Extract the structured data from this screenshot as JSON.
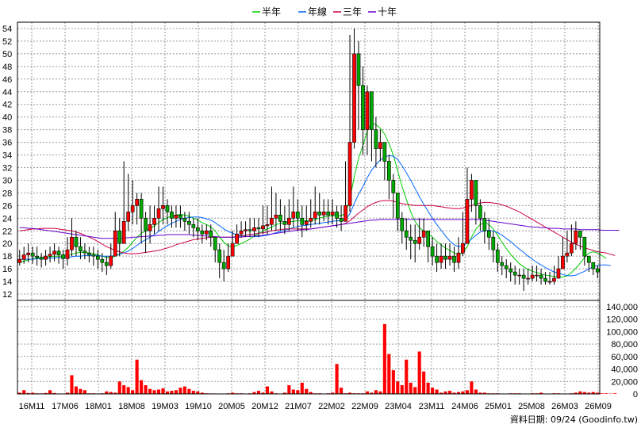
{
  "legend": [
    {
      "label": "半年",
      "color": "#00cc00"
    },
    {
      "label": "年線",
      "color": "#0066ff"
    },
    {
      "label": "三年",
      "color": "#cc0044"
    },
    {
      "label": "十年",
      "color": "#6600cc"
    }
  ],
  "source_text": "資料日期: 09/24  (Goodinfo.tw)",
  "colors": {
    "up": "#ff0000",
    "down": "#00aa00",
    "volume": "#ff0000",
    "grid": "#999999"
  },
  "chart_data": {
    "type": "candlestick+bar",
    "price_axis": {
      "ticks": [
        12,
        14,
        16,
        18,
        20,
        22,
        24,
        26,
        28,
        30,
        32,
        34,
        36,
        38,
        40,
        42,
        44,
        46,
        48,
        50,
        52,
        54
      ],
      "ylim": [
        11,
        55
      ]
    },
    "volume_axis": {
      "ticks": [
        "0",
        "20,000",
        "40,000",
        "60,000",
        "80,000",
        "100,000",
        "120,000",
        "140,000"
      ],
      "ylim": [
        0,
        150000
      ]
    },
    "x_labels": [
      "16M11",
      "17M06",
      "18M01",
      "18M08",
      "19M03",
      "19M10",
      "20M05",
      "20M12",
      "21M07",
      "22M02",
      "22M09",
      "23M04",
      "23M11",
      "24M06",
      "25M01",
      "25M08",
      "26M03",
      "26M09"
    ],
    "close": [
      17.5,
      18.2,
      18.5,
      18,
      17.8,
      17.5,
      18,
      18.3,
      18.8,
      18.2,
      17.6,
      19,
      21,
      19.5,
      18.8,
      18.5,
      18.2,
      18,
      17.5,
      17,
      16.5,
      18,
      22,
      20,
      23.5,
      25,
      26,
      27,
      24,
      22,
      23,
      24,
      25.5,
      26,
      25,
      24,
      24.5,
      24,
      23.5,
      23,
      22.5,
      22,
      21.5,
      22,
      21,
      19,
      17,
      16,
      18,
      20,
      21.5,
      22,
      22.2,
      22,
      22.5,
      22.3,
      22.8,
      23,
      24,
      24.5,
      23.5,
      23,
      24,
      25,
      24,
      23,
      23.5,
      24,
      25,
      24.5,
      25,
      24.5,
      25,
      24,
      23.5,
      26,
      36,
      50,
      45,
      38,
      44,
      38,
      35,
      36,
      33,
      30,
      28,
      24,
      22,
      21,
      20.5,
      20,
      21,
      22,
      19.5,
      18,
      17,
      18,
      17.5,
      18,
      17,
      18.5,
      20,
      27,
      30,
      26,
      24,
      22,
      21,
      19,
      17,
      16.5,
      16,
      15.5,
      15,
      15,
      14.5,
      14.5,
      15,
      15,
      14.5,
      14,
      14,
      14.5,
      16,
      18,
      18.5,
      20,
      22,
      21,
      18,
      17,
      16,
      15.5
    ],
    "high": [
      19,
      19.5,
      20,
      19.5,
      19.5,
      18.5,
      19,
      19.5,
      20,
      19.5,
      19,
      21,
      24,
      22,
      21,
      20,
      19.5,
      19.5,
      19,
      18.5,
      18,
      20,
      25,
      24,
      33,
      31,
      30,
      28,
      28,
      25,
      26,
      26,
      29,
      29,
      27,
      26,
      26,
      26,
      25,
      25,
      24,
      24,
      23,
      23,
      23,
      21,
      20,
      19,
      20,
      22,
      23,
      23.5,
      23.5,
      24,
      24,
      24,
      26,
      26,
      29,
      28,
      27,
      26,
      27,
      29,
      27,
      26,
      26,
      27,
      29,
      28,
      27,
      27,
      27,
      26,
      26,
      33,
      53,
      54,
      52,
      48,
      45,
      42,
      40,
      38,
      36,
      34,
      31,
      28,
      25,
      24,
      23,
      23,
      24,
      24,
      22,
      21,
      20,
      20,
      20,
      20,
      19.5,
      21,
      25,
      32,
      31,
      29,
      27,
      25,
      24,
      22,
      20,
      18,
      17.5,
      17,
      16.5,
      16,
      16,
      16,
      16.5,
      16.5,
      16,
      15.5,
      15.5,
      16.5,
      18,
      21,
      22,
      23,
      23.5,
      22,
      20,
      18,
      17,
      16.5
    ],
    "low": [
      16.5,
      16.8,
      17,
      16.8,
      16.5,
      16.2,
      16.5,
      17,
      17.2,
      16.8,
      16,
      16.5,
      18,
      18,
      17.5,
      17.5,
      17,
      16.5,
      16,
      15.5,
      15,
      16,
      18,
      18,
      21,
      22,
      23,
      23,
      20,
      18.5,
      20,
      21.5,
      22,
      23,
      23,
      22.5,
      22.5,
      22.5,
      22,
      21.5,
      21,
      20.5,
      20,
      20.5,
      19.5,
      17,
      14.5,
      14,
      15.5,
      18,
      20,
      21,
      21,
      21,
      21,
      21,
      21.5,
      21.5,
      22,
      22,
      22,
      21.5,
      22,
      22.5,
      22,
      21,
      22,
      22.5,
      23,
      23,
      23.5,
      23,
      23,
      22.5,
      22,
      24,
      25,
      35,
      38,
      34,
      34,
      33,
      32,
      33,
      30,
      27,
      24,
      22,
      20,
      19,
      17.5,
      17,
      19,
      19.5,
      17,
      16.5,
      15.5,
      16,
      16,
      16.5,
      15.5,
      16,
      18,
      23,
      25,
      23,
      22,
      20,
      19,
      17,
      15.5,
      15,
      14.5,
      14,
      13.5,
      13.5,
      12.5,
      13.5,
      14,
      14,
      13.5,
      13.5,
      13.5,
      13.5,
      14.5,
      16,
      17,
      18,
      19,
      19,
      16.5,
      15.5,
      15,
      14.5
    ],
    "ma_half": [
      17,
      17.2,
      17.4,
      17.6,
      17.7,
      17.8,
      17.8,
      17.9,
      18,
      18,
      18,
      18.1,
      18.3,
      18.5,
      18.6,
      18.6,
      18.5,
      18.4,
      18.2,
      18,
      17.8,
      17.7,
      18,
      18.3,
      18.8,
      19.4,
      20.2,
      21,
      21.6,
      22,
      22.4,
      22.8,
      23.3,
      23.8,
      24.1,
      24.3,
      24.5,
      24.6,
      24.5,
      24.3,
      24,
      23.7,
      23.3,
      23,
      22.6,
      22,
      21,
      20.2,
      19.6,
      19.5,
      19.7,
      20,
      20.3,
      20.7,
      21.2,
      21.6,
      22,
      22.3,
      22.6,
      23,
      23.2,
      23.3,
      23.4,
      23.5,
      23.6,
      23.6,
      23.6,
      23.6,
      23.8,
      24,
      24.2,
      24.3,
      24.4,
      24.4,
      24.4,
      24.8,
      27,
      30.5,
      33.5,
      35.5,
      37.8,
      39,
      38.8,
      38.2,
      37.3,
      35.8,
      34,
      31.5,
      29,
      27,
      25,
      23.5,
      22.5,
      22,
      21.6,
      21,
      20.3,
      19.8,
      19.3,
      18.9,
      18.5,
      18.3,
      18.5,
      19.5,
      21,
      22.3,
      23,
      23.3,
      23,
      22.3,
      21.3,
      20.2,
      19.2,
      18.3,
      17.5,
      16.8,
      16.3,
      15.9,
      15.6,
      15.4,
      15.2,
      15,
      14.9,
      14.8,
      14.7,
      14.7,
      14.9,
      15.4,
      16.1,
      16.9,
      17.8,
      18.5,
      18.7,
      18.5,
      18.1,
      17.6
    ],
    "ma_year": [
      17.5,
      17.5,
      17.5,
      17.5,
      17.6,
      17.6,
      17.6,
      17.7,
      17.7,
      17.8,
      17.8,
      17.8,
      17.9,
      18,
      18,
      18.1,
      18.1,
      18.1,
      18.1,
      18,
      18,
      18,
      18.1,
      18.3,
      18.5,
      18.8,
      19.2,
      19.7,
      20.2,
      20.6,
      21,
      21.4,
      21.9,
      22.4,
      22.8,
      23.2,
      23.5,
      23.8,
      24,
      24.1,
      24.2,
      24.2,
      24.1,
      23.9,
      23.7,
      23.3,
      22.8,
      22.3,
      21.9,
      21.6,
      21.4,
      21.2,
      21.1,
      21.1,
      21.1,
      21.1,
      21.2,
      21.3,
      21.5,
      21.7,
      21.9,
      22.1,
      22.3,
      22.5,
      22.7,
      22.8,
      22.9,
      23,
      23.1,
      23.2,
      23.3,
      23.4,
      23.5,
      23.6,
      23.6,
      23.8,
      24.7,
      26.3,
      27.8,
      29,
      30.4,
      31.6,
      32.5,
      33.2,
      33.7,
      33.9,
      33.8,
      33.3,
      32.3,
      31.2,
      30,
      28.7,
      27.4,
      26.2,
      25.1,
      24,
      23,
      22.1,
      21.2,
      20.4,
      19.8,
      19.5,
      19.6,
      20.1,
      20.7,
      21.3,
      21.8,
      22,
      22.1,
      22,
      21.7,
      21.3,
      20.8,
      20.3,
      19.7,
      19.1,
      18.6,
      18,
      17.5,
      17,
      16.6,
      16.2,
      15.8,
      15.5,
      15.3,
      15.1,
      14.9,
      14.9,
      15,
      15.3,
      15.6,
      16,
      16.3,
      16.5,
      16.6,
      16.6,
      16.5
    ],
    "ma_3y": [
      22,
      22.1,
      22.2,
      22.3,
      22.3,
      22.4,
      22.4,
      22.4,
      22.4,
      22.3,
      22.2,
      22.1,
      22,
      21.8,
      21.6,
      21.3,
      21,
      20.7,
      20.3,
      19.9,
      19.5,
      19.2,
      18.9,
      18.7,
      18.5,
      18.4,
      18.4,
      18.4,
      18.5,
      18.6,
      18.7,
      18.8,
      18.9,
      19.1,
      19.3,
      19.5,
      19.8,
      20,
      20.2,
      20.4,
      20.6,
      20.7,
      20.8,
      20.9,
      21,
      21,
      21,
      21,
      21,
      21,
      21.1,
      21.2,
      21.3,
      21.4,
      21.5,
      21.6,
      21.7,
      21.8,
      22,
      22.1,
      22.2,
      22.3,
      22.3,
      22.3,
      22.3,
      22.3,
      22.3,
      22.3,
      22.4,
      22.5,
      22.6,
      22.7,
      22.8,
      22.9,
      23,
      23.2,
      23.6,
      24.2,
      24.8,
      25.3,
      25.8,
      26.2,
      26.5,
      26.7,
      26.8,
      26.8,
      26.7,
      26.5,
      26.3,
      26.2,
      26.1,
      26,
      26,
      26,
      26,
      26,
      25.9,
      25.8,
      25.7,
      25.6,
      25.5,
      25.5,
      25.6,
      25.8,
      26,
      26.2,
      26.4,
      26.5,
      26.5,
      26.4,
      26.3,
      26.1,
      25.9,
      25.6,
      25.3,
      25,
      24.6,
      24.2,
      23.8,
      23.4,
      23,
      22.6,
      22.2,
      21.8,
      21.4,
      21,
      20.6,
      20.2,
      19.9,
      19.6,
      19.3,
      19.1,
      18.9,
      18.7,
      18.6,
      18.5,
      18.3,
      18.1
    ],
    "ma_10y": [
      22.5,
      22.5,
      22.4,
      22.4,
      22.3,
      22.2,
      22.1,
      22,
      21.9,
      21.8,
      21.7,
      21.6,
      21.5,
      21.4,
      21.3,
      21.2,
      21.1,
      21,
      20.9,
      20.8,
      20.8,
      20.8,
      20.8,
      20.8,
      20.9,
      20.9,
      21,
      21,
      21.1,
      21.1,
      21.2,
      21.2,
      21.3,
      21.3,
      21.4,
      21.4,
      21.4,
      21.4,
      21.4,
      21.4,
      21.3,
      21.3,
      21.2,
      21.2,
      21.1,
      21.1,
      21,
      21,
      21,
      21,
      21,
      21,
      21.1,
      21.1,
      21.2,
      21.2,
      21.3,
      21.4,
      21.5,
      21.6,
      21.7,
      21.8,
      21.9,
      22,
      22.1,
      22.2,
      22.2,
      22.3,
      22.4,
      22.5,
      22.6,
      22.7,
      22.8,
      22.9,
      23,
      23.1,
      23.2,
      23.3,
      23.4,
      23.5,
      23.6,
      23.7,
      23.7,
      23.8,
      23.8,
      23.8,
      23.8,
      23.8,
      23.8,
      23.8,
      23.8,
      23.8,
      23.8,
      23.8,
      23.8,
      23.8,
      23.8,
      23.8,
      23.8,
      23.8,
      23.8,
      23.8,
      23.8,
      23.8,
      23.8,
      23.8,
      23.8,
      23.7,
      23.6,
      23.5,
      23.4,
      23.3,
      23.2,
      23.1,
      23,
      22.9,
      22.8,
      22.7,
      22.6,
      22.6,
      22.5,
      22.5,
      22.4,
      22.4,
      22.4,
      22.3,
      22.3,
      22.3,
      22.3,
      22.2,
      22.2,
      22.2,
      22.2,
      22.2,
      22.1,
      22.1,
      22.1,
      22.1,
      22.1
    ],
    "volume": [
      2000,
      6000,
      1500,
      2000,
      1000,
      800,
      1500,
      6000,
      1500,
      500,
      300,
      2000,
      30000,
      12000,
      8000,
      6000,
      1000,
      1000,
      500,
      1000,
      4000,
      3000,
      2000,
      20000,
      14000,
      11000,
      6000,
      55000,
      22000,
      14000,
      8000,
      6000,
      7000,
      9000,
      4000,
      5000,
      6000,
      10000,
      12000,
      8000,
      5000,
      4000,
      2000,
      1000,
      800,
      700,
      500,
      500,
      1000,
      2000,
      1000,
      1000,
      500,
      1000,
      3000,
      5000,
      2000,
      12000,
      4000,
      1000,
      500,
      2000,
      14000,
      7000,
      6000,
      18000,
      8000,
      3000,
      1000,
      1000,
      500,
      1000,
      2000,
      48000,
      10000,
      1000,
      2000,
      1000,
      1000,
      1000,
      4000,
      2000,
      6000,
      4000,
      112000,
      64000,
      38000,
      20000,
      14000,
      55000,
      18000,
      11000,
      68000,
      36000,
      18000,
      10000,
      7000,
      2000,
      4000,
      5000,
      2000,
      3000,
      4000,
      6000,
      20000,
      7000,
      2000,
      2000,
      1000,
      1000,
      1000,
      500,
      500,
      1000,
      1000,
      1000,
      500,
      500,
      1000,
      1000,
      2000,
      500,
      500,
      1000,
      1000,
      500,
      500,
      1000,
      2000,
      4000,
      3000,
      2000,
      3000,
      2000,
      1000,
      1000,
      500,
      1000
    ]
  }
}
